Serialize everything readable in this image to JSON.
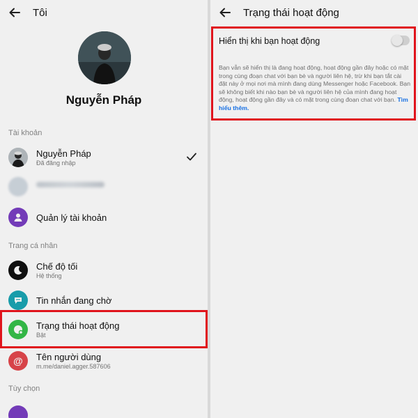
{
  "left": {
    "title": "Tôi",
    "profile_name": "Nguyễn Pháp",
    "section_account": "Tài khoản",
    "account": {
      "name": "Nguyễn Pháp",
      "status": "Đã đăng nhập"
    },
    "manage_account": "Quản lý tài khoản",
    "section_personal": "Trang cá nhân",
    "dark_mode": {
      "label": "Chế độ tối",
      "value": "Hệ thống"
    },
    "pending_messages": "Tin nhắn đang chờ",
    "active_status": {
      "label": "Trạng thái hoạt động",
      "value": "Bật"
    },
    "username": {
      "label": "Tên người dùng",
      "value": "m.me/daniel.agger.587606"
    },
    "section_options": "Tùy chọn"
  },
  "right": {
    "title": "Trạng thái hoạt động",
    "setting_label": "Hiển thị khi bạn hoạt động",
    "toggle_on": false,
    "description": "Bạn vẫn sẽ hiển thị là đang hoạt động, hoạt động gần đây hoặc có mặt trong cùng đoạn chat với bạn bè và người liên hệ, trừ khi bạn tắt cài đặt này ở mọi nơi mà mình đang dùng Messenger hoặc Facebook. Bạn sẽ không biết khi nào bạn bè và người liên hệ của mình đang hoạt động, hoạt động gần đây và có mặt trong cùng đoạn chat với bạn.",
    "learn_more": "Tìm hiểu thêm."
  },
  "colors": {
    "highlight": "#e0141c",
    "purple": "#7b3fc4",
    "green": "#37c24b",
    "dark": "#111111",
    "teal": "#1aa6b5",
    "red": "#e5484d",
    "link": "#1877f2"
  }
}
